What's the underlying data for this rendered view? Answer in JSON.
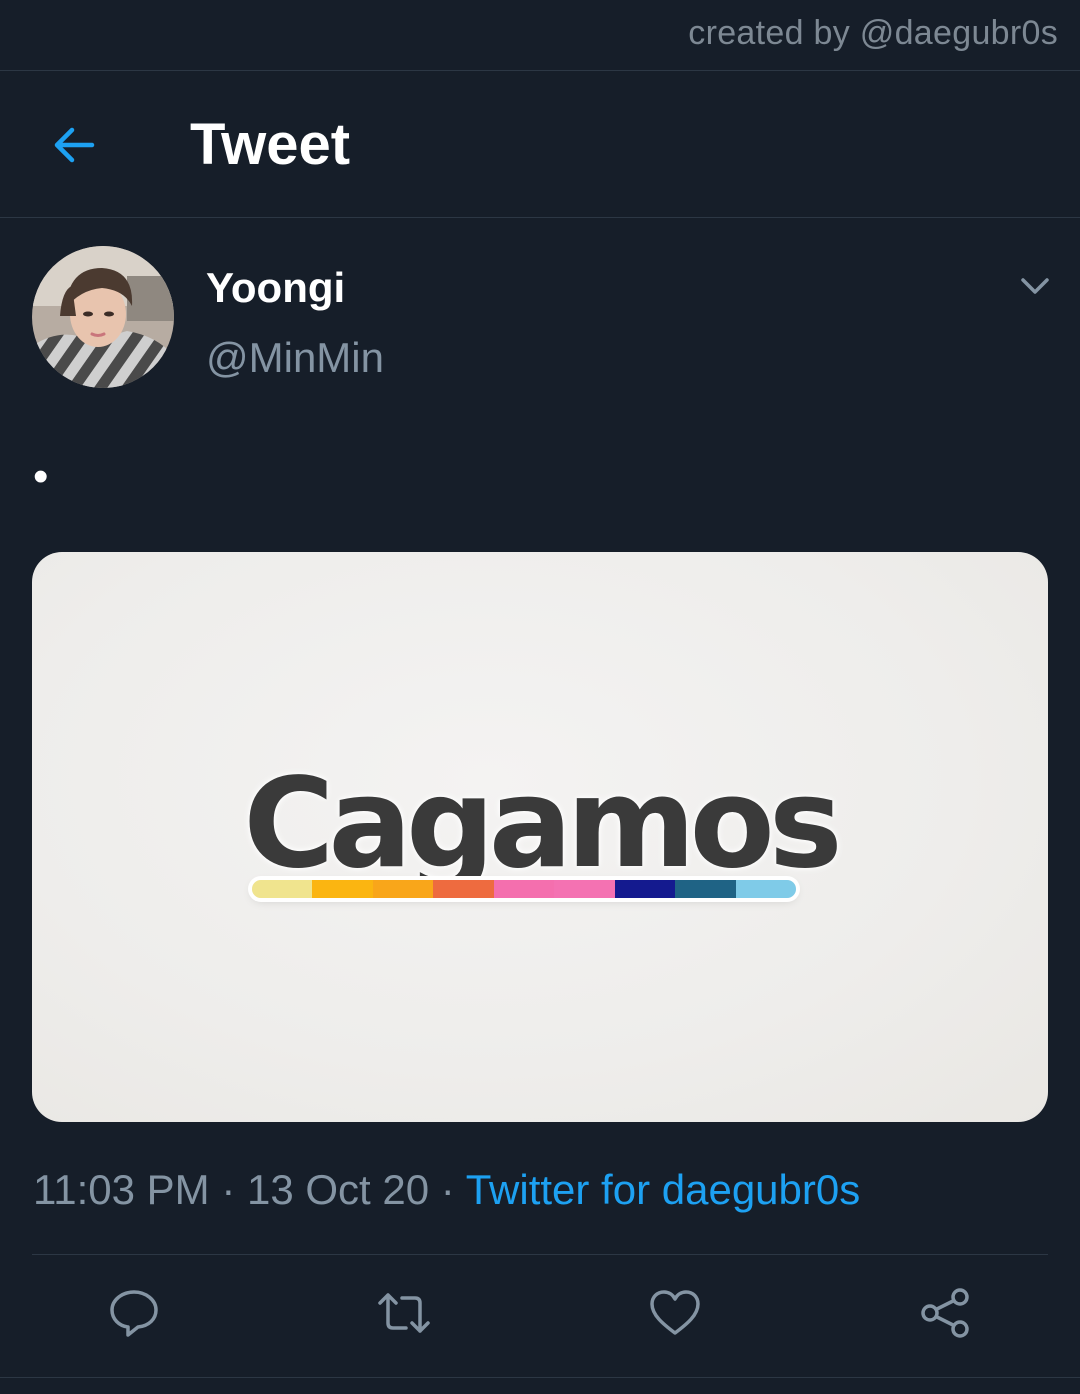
{
  "watermark": "created by @daegubr0s",
  "header": {
    "title": "Tweet",
    "back_icon": "arrow-left-icon"
  },
  "tweet": {
    "author": {
      "display_name": "Yoongi",
      "handle": "@MinMin"
    },
    "text": "•",
    "media": {
      "logo_text": "Cagamos",
      "stripe_colors": [
        "#f0e48e",
        "#fbb511",
        "#f9a61a",
        "#ee6b3f",
        "#f46fae",
        "#f472b2",
        "#141a8f",
        "#1f6385",
        "#7fcbe8"
      ]
    },
    "time": "11:03 PM",
    "separator": "·",
    "date": "13 Oct 20",
    "source": "Twitter for daegubr0s"
  },
  "actions": [
    "reply-icon",
    "retweet-icon",
    "like-icon",
    "share-icon"
  ],
  "colors": {
    "background": "#161e29",
    "accent": "#1da1f2",
    "secondary_text": "#8494a3"
  }
}
